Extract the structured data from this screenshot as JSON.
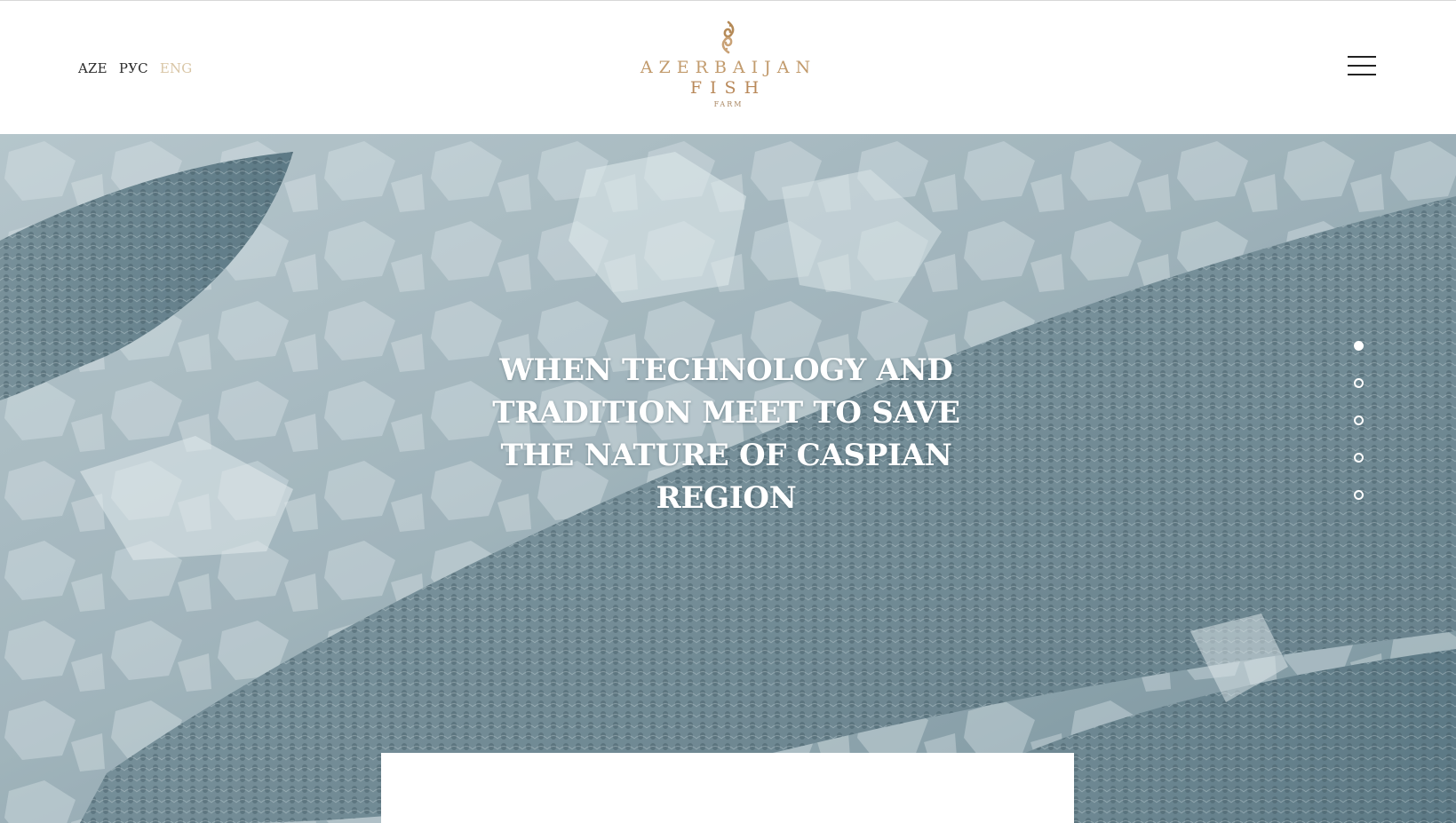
{
  "header": {
    "languages": [
      {
        "label": "AZE",
        "active": false
      },
      {
        "label": "РУС",
        "active": false
      },
      {
        "label": "ENG",
        "active": true
      }
    ],
    "logo": {
      "line1": "AZERBAIJAN",
      "line2": "FISH",
      "line3": "FARM",
      "mark_icon": "twin-fish-icon",
      "color": "#b58a57"
    },
    "menu_icon": "hamburger-menu-icon"
  },
  "hero": {
    "title": "WHEN TECHNOLOGY AND TRADITION MEET TO SAVE THE NATURE OF CASPIAN REGION",
    "background": "fish-on-ice-photo",
    "slides": {
      "count": 5,
      "active_index": 0
    }
  },
  "colors": {
    "accent_gold": "#c29b6d",
    "text_dark": "#2b2b2b",
    "lang_active": "#d9c6a6",
    "hero_tint": "#8fa4ad"
  }
}
